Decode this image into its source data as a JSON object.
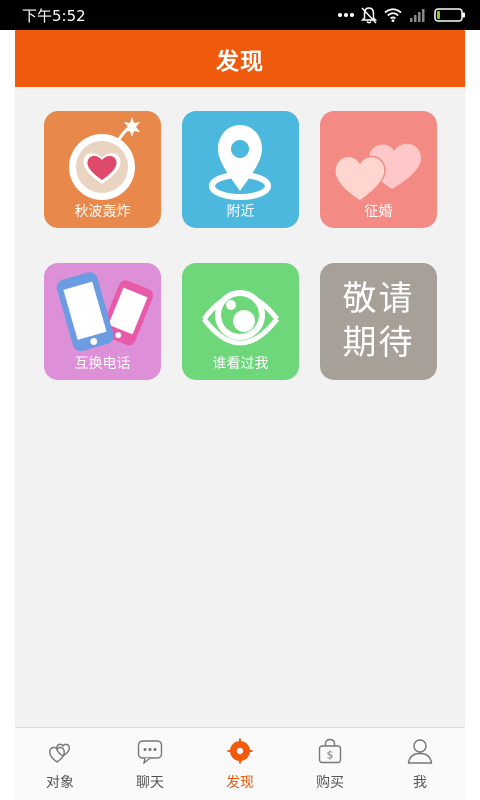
{
  "status_bar": {
    "time": "下午5:52"
  },
  "header": {
    "title": "发现"
  },
  "tiles": [
    {
      "label": "秋波轰炸"
    },
    {
      "label": "附近"
    },
    {
      "label": "征婚"
    },
    {
      "label": "互换电话"
    },
    {
      "label": "谁看过我"
    },
    {
      "line1": "敬请",
      "line2": "期待"
    }
  ],
  "tabs": [
    {
      "label": "对象",
      "icon": "hearts-icon"
    },
    {
      "label": "聊天",
      "icon": "chat-bubble-icon"
    },
    {
      "label": "发现",
      "icon": "compass-icon",
      "active": true
    },
    {
      "label": "购买",
      "icon": "shopping-bag-icon"
    },
    {
      "label": "我",
      "icon": "user-icon"
    }
  ],
  "colors": {
    "accent": "#ef5a0c",
    "bomb_tile": "#e8884a",
    "nearby_tile": "#4db8de",
    "marry_tile": "#f48a84",
    "swap_tile": "#dd8fd8",
    "viewed_tile": "#6dd77a",
    "soon_tile": "#a7a098"
  }
}
